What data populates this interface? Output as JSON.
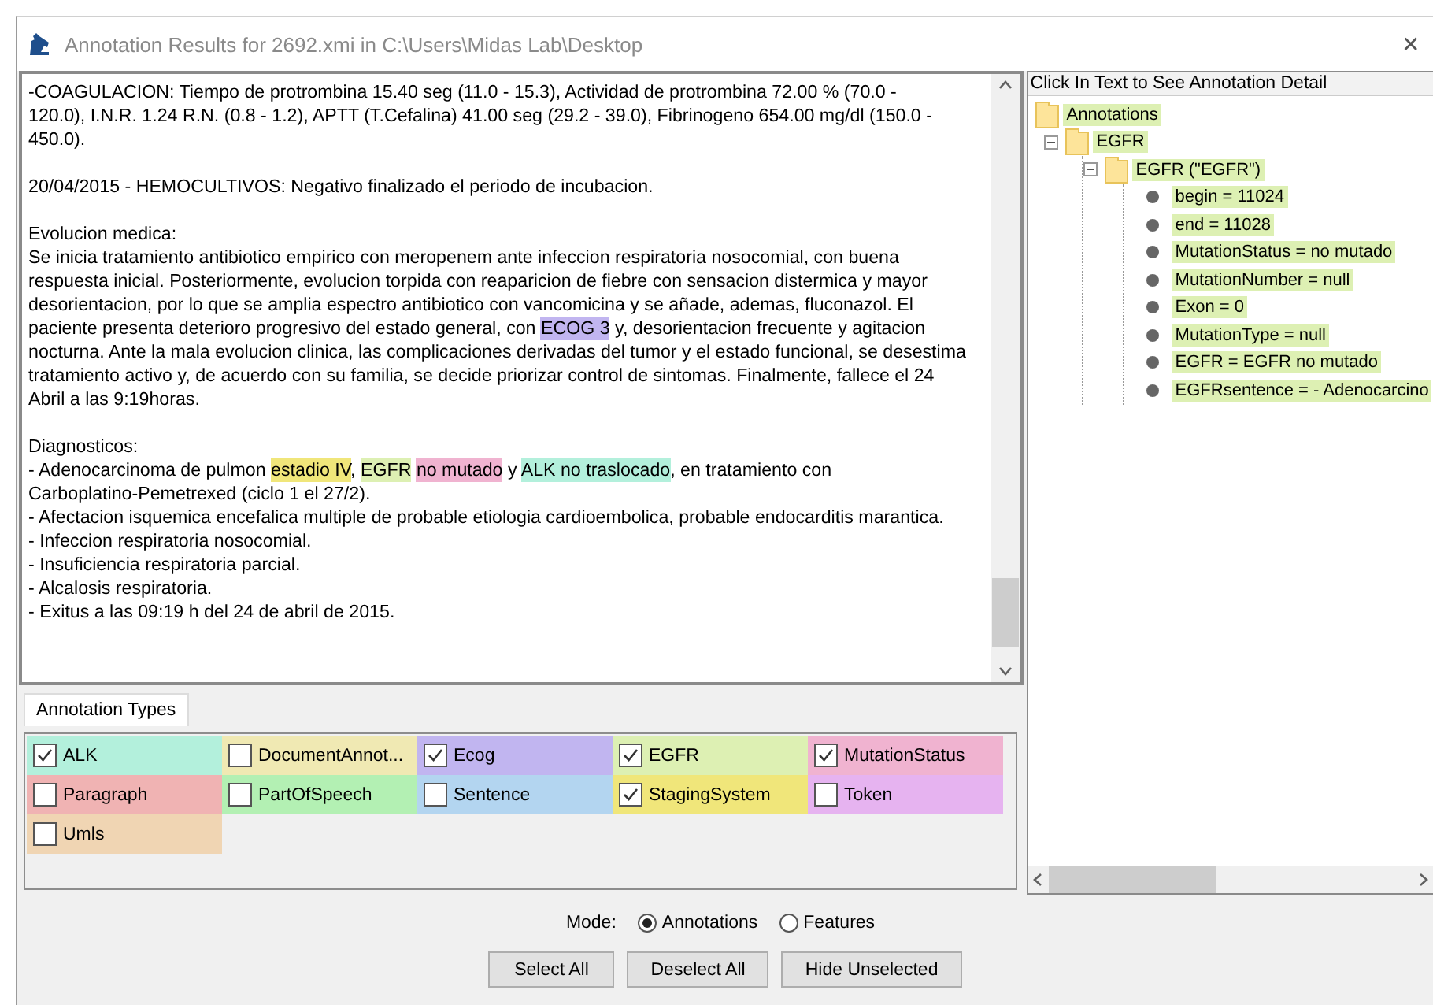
{
  "window": {
    "title": "Annotation Results for 2692.xmi in C:\\Users\\Midas Lab\\Desktop",
    "close": "✕"
  },
  "document": {
    "paragraphs": [
      [
        [
          {
            "text": "-COAGULACION: Tiempo de protrombina 15.40 seg (11.0 - 15.3), Actividad de protrombina 72.00 % (70.0 -"
          }
        ],
        [
          {
            "text": "120.0), I.N.R. 1.24 R.N. (0.8 - 1.2), APTT (T.Cefalina) 41.00 seg (29.2 - 39.0), Fibrinogeno 654.00 mg/dl (150.0 -"
          }
        ],
        [
          {
            "text": "450.0)."
          }
        ]
      ],
      [
        [
          {
            "text": "20/04/2015 - HEMOCULTIVOS: Negativo finalizado el periodo de incubacion."
          }
        ]
      ],
      [
        [
          {
            "text": "Evolucion medica:"
          }
        ],
        [
          {
            "text": "Se inicia tratamiento antibiotico empirico con meropenem ante infeccion respiratoria nosocomial, con buena"
          }
        ],
        [
          {
            "text": "respuesta inicial. Posteriormente, evolucion torpida con reaparicion de fiebre con sensacion distermica y mayor"
          }
        ],
        [
          {
            "text": "desorientacion, por lo que se amplia espectro antibiotico con vancomicina y se añade, ademas, fluconazol. El"
          }
        ],
        [
          {
            "text": "paciente presenta deterioro progresivo del estado general, con "
          },
          {
            "text": "ECOG 3",
            "color": "#c1b5f0"
          },
          {
            "text": " y, desorientacion frecuente y agitacion"
          }
        ],
        [
          {
            "text": "nocturna. Ante la mala evolucion clinica, las complicaciones derivadas del tumor y el estado funcional, se desestima"
          }
        ],
        [
          {
            "text": "tratamiento activo y, de acuerdo con su familia, se decide priorizar control de sintomas. Finalmente, fallece el 24"
          }
        ],
        [
          {
            "text": "Abril a las 9:19horas."
          }
        ]
      ],
      [
        [
          {
            "text": "Diagnosticos:"
          }
        ],
        [
          {
            "text": "- Adenocarcinoma de pulmon "
          },
          {
            "text": "estadio IV",
            "color": "#f0e67a"
          },
          {
            "text": ", "
          },
          {
            "text": "EGFR",
            "color": "#ddf0b3"
          },
          {
            "text": "no mutado",
            "color": "#f0b3d0",
            "gap_before": true
          },
          {
            "text": " y "
          },
          {
            "text": "ALK no traslocado",
            "color": "#b3f0dc"
          },
          {
            "text": ", en tratamiento con"
          }
        ],
        [
          {
            "text": "Carboplatino-Pemetrexed (ciclo 1 el 27/2)."
          }
        ],
        [
          {
            "text": "- Afectacion isquemica encefalica multiple de probable etiologia cardioembolica, probable endocarditis marantica."
          }
        ],
        [
          {
            "text": "- Infeccion respiratoria nosocomial."
          }
        ],
        [
          {
            "text": "- Insuficiencia respiratoria parcial."
          }
        ],
        [
          {
            "text": "- Alcalosis respiratoria."
          }
        ],
        [
          {
            "text": "- Exitus a las 09:19 h del 24 de abril de 2015."
          }
        ]
      ]
    ]
  },
  "tabs": [
    {
      "label": "Annotation Types",
      "selected": true
    }
  ],
  "types": [
    {
      "label": "ALK",
      "checked": true,
      "color": "#b3f0dc"
    },
    {
      "label": "DocumentAnnot...",
      "checked": false,
      "color": "#f0e9b3"
    },
    {
      "label": "Ecog",
      "checked": true,
      "color": "#c1b5f0"
    },
    {
      "label": "EGFR",
      "checked": true,
      "color": "#ddf0b3"
    },
    {
      "label": "MutationStatus",
      "checked": true,
      "color": "#f0b3d0"
    },
    {
      "label": "Paragraph",
      "checked": false,
      "color": "#f0b3b3"
    },
    {
      "label": "PartOfSpeech",
      "checked": false,
      "color": "#b3f0b3"
    },
    {
      "label": "Sentence",
      "checked": false,
      "color": "#b3d5f0"
    },
    {
      "label": "StagingSystem",
      "checked": true,
      "color": "#f0e67a"
    },
    {
      "label": "Token",
      "checked": false,
      "color": "#e6b3f0"
    },
    {
      "label": "Umls",
      "checked": false,
      "color": "#f0d5b3"
    }
  ],
  "detail": {
    "header": "Click In Text to See Annotation Detail",
    "tree": {
      "label": "Annotations",
      "children": [
        {
          "label": "EGFR",
          "expanded": true,
          "children": [
            {
              "label": "EGFR (\"EGFR\")",
              "expanded": true,
              "children": [
                {
                  "label": "begin = 11024"
                },
                {
                  "label": "end = 11028"
                },
                {
                  "label": "MutationStatus = no mutado"
                },
                {
                  "label": "MutationNumber = null"
                },
                {
                  "label": "Exon = 0"
                },
                {
                  "label": "MutationType = null"
                },
                {
                  "label": "EGFR = EGFR no mutado"
                },
                {
                  "label": "EGFRsentence = - Adenocarcino"
                }
              ]
            }
          ]
        }
      ]
    }
  },
  "mode": {
    "label": "Mode:",
    "options": [
      {
        "label": "Annotations",
        "selected": true
      },
      {
        "label": "Features",
        "selected": false
      }
    ]
  },
  "buttons": [
    "Select All",
    "Deselect All",
    "Hide Unselected"
  ]
}
